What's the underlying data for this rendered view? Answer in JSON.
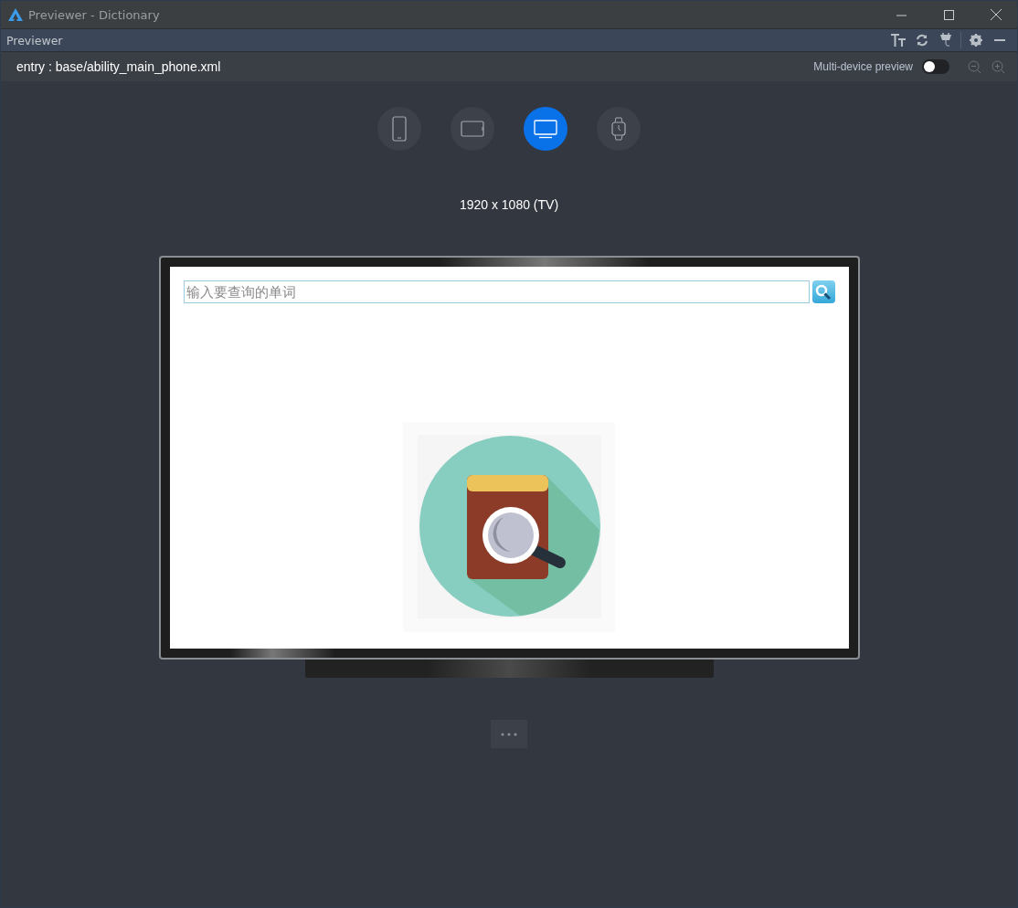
{
  "window": {
    "title": "Previewer - Dictionary"
  },
  "panel": {
    "title": "Previewer"
  },
  "toolbar": {
    "file_path": "entry : base/ability_main_phone.xml",
    "multi_device_preview": {
      "label": "Multi-device preview",
      "on": false
    }
  },
  "devices": [
    {
      "kind": "phone",
      "selected": false
    },
    {
      "kind": "tablet",
      "selected": false
    },
    {
      "kind": "tv",
      "selected": true
    },
    {
      "kind": "watch",
      "selected": false
    }
  ],
  "resolution": "1920 x 1080 (TV)",
  "app": {
    "search": {
      "placeholder": "输入要查询的单词"
    }
  }
}
